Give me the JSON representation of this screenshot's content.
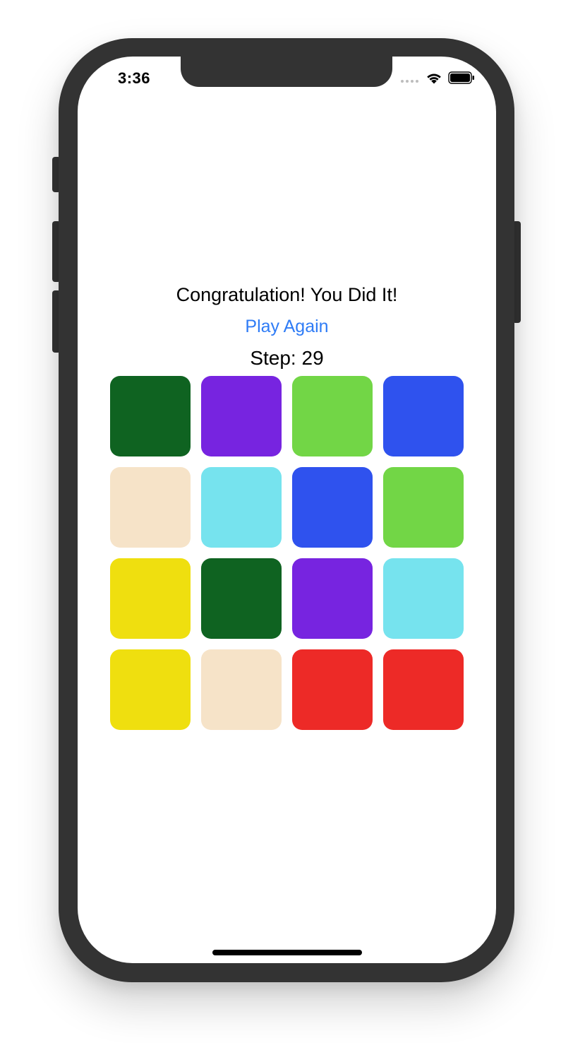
{
  "status_bar": {
    "time": "3:36",
    "icons": [
      "signal-dots-icon",
      "wifi-icon",
      "battery-icon"
    ]
  },
  "game": {
    "message": "Congratulation! You Did It!",
    "play_again_label": "Play Again",
    "step_label": "Step:",
    "step_count": "29",
    "accent_color": "#2f7cf6",
    "tiles": [
      {
        "color": "#0f6321"
      },
      {
        "color": "#7724e0"
      },
      {
        "color": "#72d646"
      },
      {
        "color": "#2f52ee"
      },
      {
        "color": "#f6e3c8"
      },
      {
        "color": "#76e3ee"
      },
      {
        "color": "#2f52ee"
      },
      {
        "color": "#72d646"
      },
      {
        "color": "#efdf0f"
      },
      {
        "color": "#0f6321"
      },
      {
        "color": "#7724e0"
      },
      {
        "color": "#76e3ee"
      },
      {
        "color": "#efdf0f"
      },
      {
        "color": "#f6e3c8"
      },
      {
        "color": "#ed2a27"
      },
      {
        "color": "#ed2a27"
      }
    ]
  }
}
